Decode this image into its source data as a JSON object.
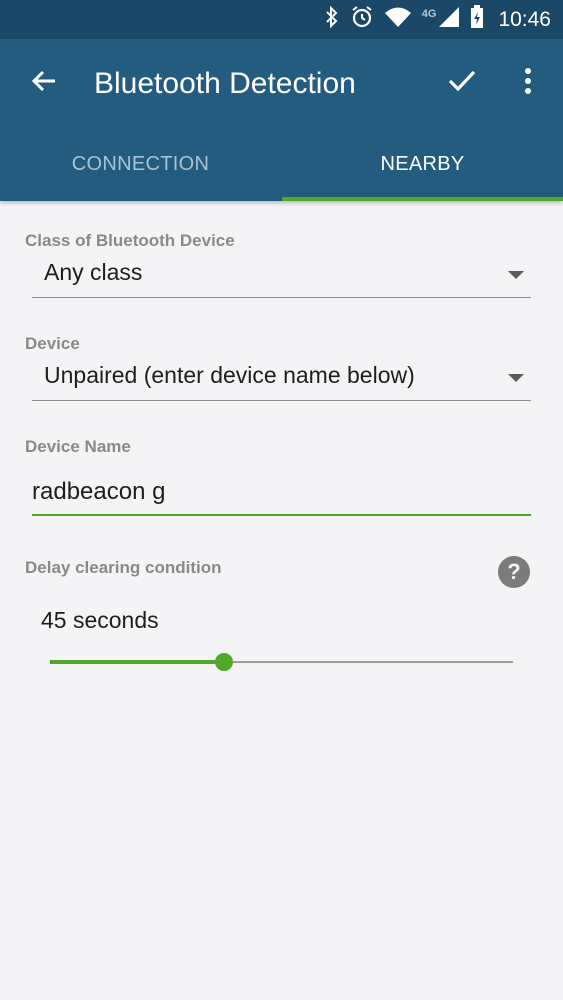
{
  "status_bar": {
    "time": "10:46",
    "network": "4G"
  },
  "app_bar": {
    "title": "Bluetooth Detection",
    "back_icon": "arrow-left-icon",
    "confirm_icon": "check-icon",
    "more_icon": "more-vert-icon"
  },
  "tabs": [
    {
      "label": "CONNECTION",
      "selected": false
    },
    {
      "label": "NEARBY",
      "selected": true
    }
  ],
  "form": {
    "device_class": {
      "label": "Class of Bluetooth Device",
      "value": "Any class"
    },
    "device": {
      "label": "Device",
      "value": "Unpaired (enter device name below)"
    },
    "device_name": {
      "label": "Device Name",
      "value": "radbeacon g"
    },
    "delay": {
      "label": "Delay clearing condition",
      "value_text": "45 seconds",
      "slider_fraction": 0.375,
      "help_icon": "help-circle-icon"
    }
  },
  "colors": {
    "status_bar": "#1b4866",
    "app_bar": "#235c7e",
    "accent": "#4fa82a",
    "background": "#f4f3f6"
  }
}
